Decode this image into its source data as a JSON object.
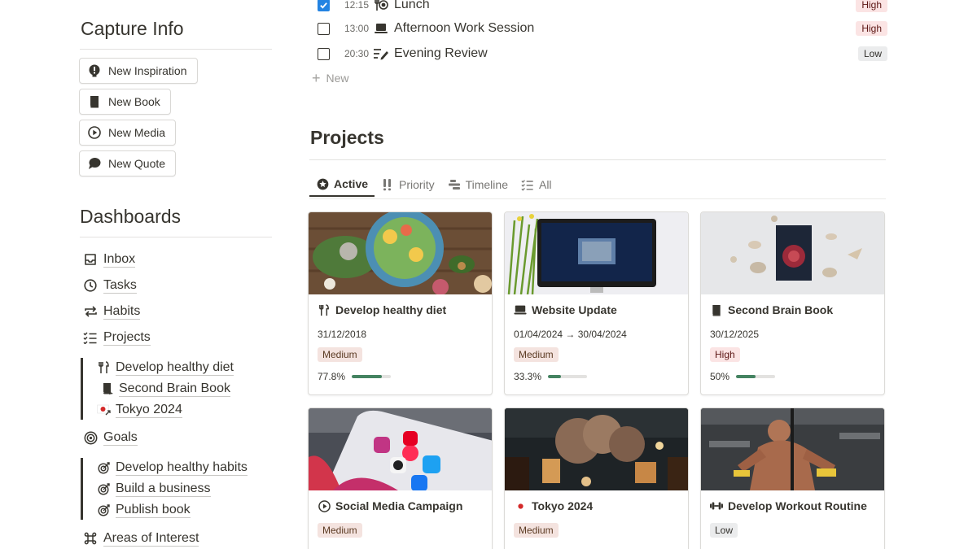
{
  "tasks": [
    {
      "time": "12:15",
      "name": "Lunch",
      "priority": "High",
      "checked": true,
      "icon": "utensils-icon"
    },
    {
      "time": "13:00",
      "name": "Afternoon Work Session",
      "priority": "High",
      "checked": false,
      "icon": "laptop-icon"
    },
    {
      "time": "20:30",
      "name": "Evening Review",
      "priority": "Low",
      "checked": false,
      "icon": "edit-list-icon"
    }
  ],
  "new_label": "New",
  "capture": {
    "title": "Capture Info",
    "buttons": [
      {
        "label": "New Inspiration",
        "icon": "lightbulb-icon"
      },
      {
        "label": "New Book",
        "icon": "book-icon"
      },
      {
        "label": "New Media",
        "icon": "play-icon"
      },
      {
        "label": "New Quote",
        "icon": "speech-bubble-icon"
      }
    ]
  },
  "dashboards": {
    "title": "Dashboards",
    "links": [
      {
        "label": "Inbox",
        "icon": "inbox-icon"
      },
      {
        "label": "Tasks",
        "icon": "clock-icon"
      },
      {
        "label": "Habits",
        "icon": "repeat-icon"
      },
      {
        "label": "Projects",
        "icon": "checklist-icon"
      }
    ],
    "projects_sub": [
      {
        "label": "Develop healthy diet",
        "icon": "utensils-icon"
      },
      {
        "label": "Second Brain Book",
        "icon": "book-icon"
      },
      {
        "label": "Tokyo 2024",
        "icon": "japan-flag-icon"
      }
    ],
    "goals": {
      "label": "Goals",
      "icon": "target-icon"
    },
    "goals_sub": [
      {
        "label": "Develop healthy habits",
        "icon": "goal-arrow-icon"
      },
      {
        "label": "Build a business",
        "icon": "goal-arrow-icon"
      },
      {
        "label": "Publish book",
        "icon": "goal-arrow-icon"
      }
    ],
    "areas": {
      "label": "Areas of Interest",
      "icon": "command-icon"
    }
  },
  "projects": {
    "title": "Projects",
    "tabs": [
      {
        "label": "Active",
        "icon": "star-circle-icon",
        "active": true
      },
      {
        "label": "Priority",
        "icon": "double-exclaim-icon",
        "active": false
      },
      {
        "label": "Timeline",
        "icon": "timeline-icon",
        "active": false
      },
      {
        "label": "All",
        "icon": "checklist-icon",
        "active": false
      }
    ],
    "cards": [
      {
        "title": "Develop healthy diet",
        "icon": "utensils-icon",
        "date": "31/12/2018",
        "priority": "Medium",
        "progress_label": "77.8%",
        "progress": 0.778,
        "cover": "food-bowl-cover"
      },
      {
        "title": "Website Update",
        "icon": "laptop-icon",
        "date": "01/04/2024 → 30/04/2024",
        "priority": "Medium",
        "progress_label": "33.3%",
        "progress": 0.333,
        "cover": "imac-cover"
      },
      {
        "title": "Second Brain Book",
        "icon": "book-icon",
        "date": "30/12/2025",
        "priority": "High",
        "progress_label": "50%",
        "progress": 0.5,
        "cover": "book-shells-cover"
      },
      {
        "title": "Social Media Campaign",
        "icon": "play-icon",
        "date": "",
        "priority": "Medium",
        "progress_label": "",
        "progress": null,
        "cover": "phone-apps-cover"
      },
      {
        "title": "Tokyo 2024",
        "icon": "japan-flag-icon",
        "date": "",
        "priority": "Medium",
        "progress_label": "",
        "progress": null,
        "cover": "tokyo-street-cover"
      },
      {
        "title": "Develop Workout Routine",
        "icon": "dumbbell-icon",
        "date": "",
        "priority": "Low",
        "progress_label": "",
        "progress": null,
        "cover": "gym-cover"
      }
    ]
  }
}
